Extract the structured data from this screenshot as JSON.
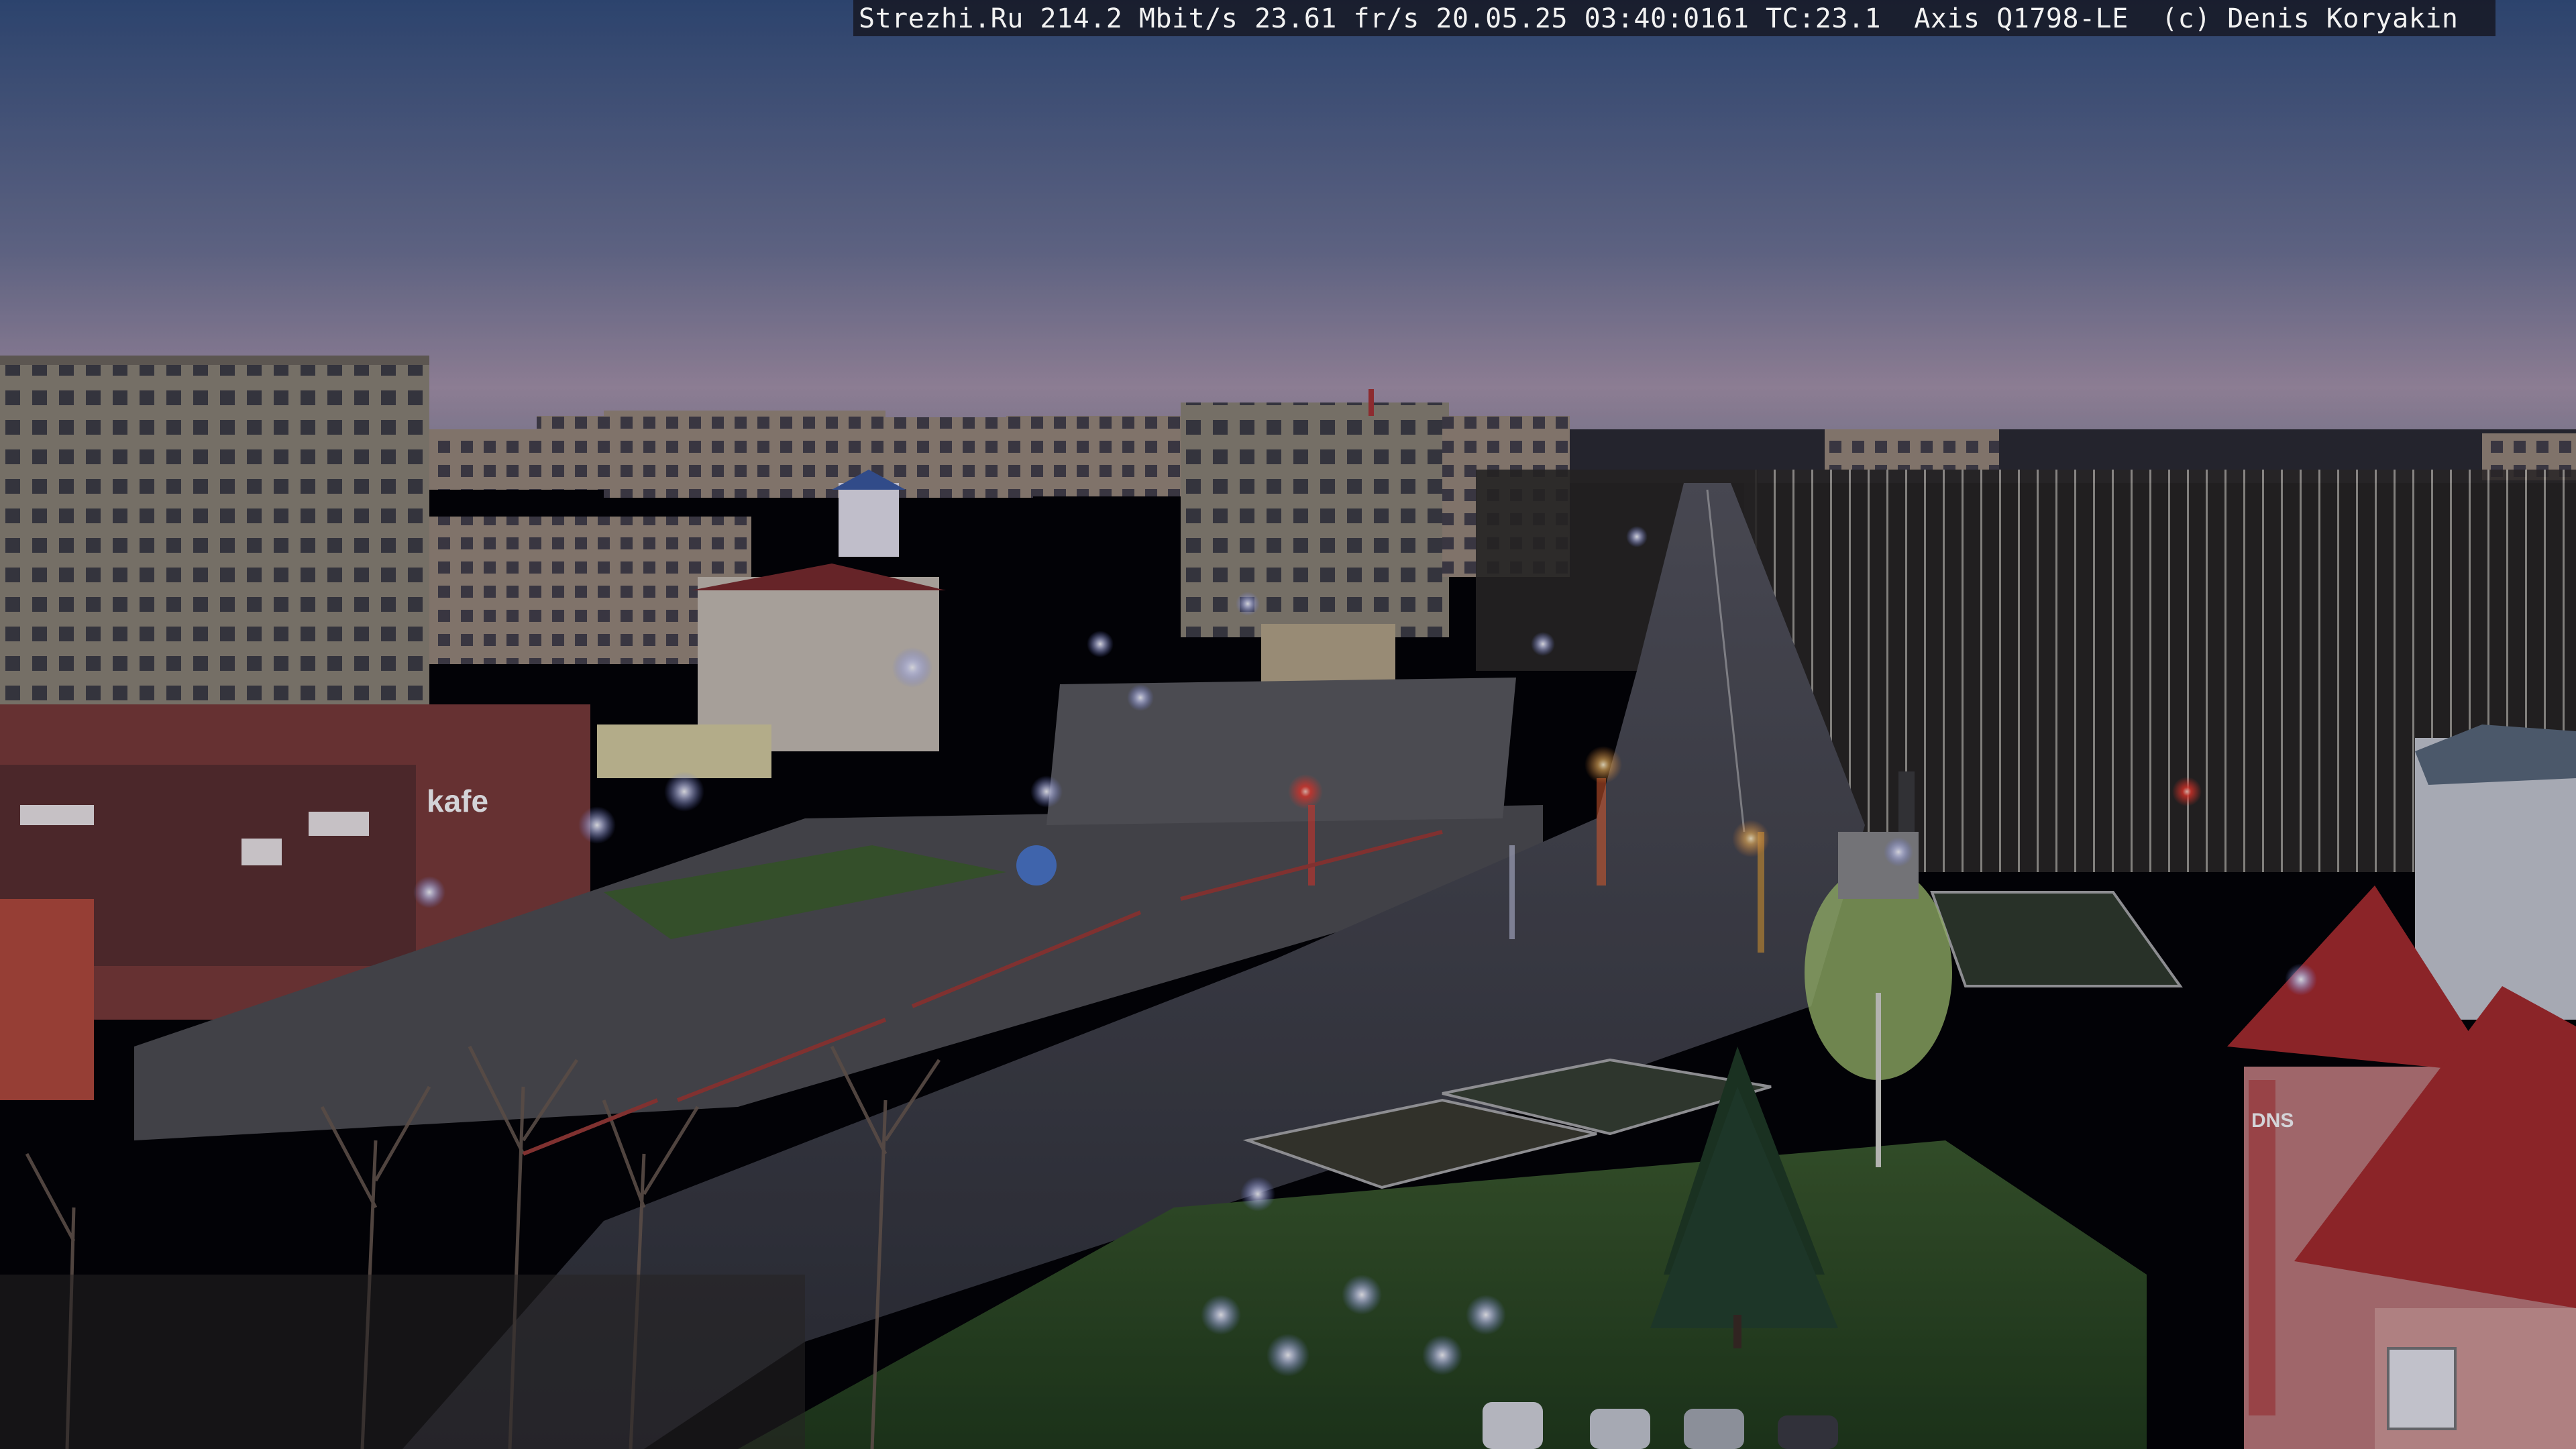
{
  "overlay": {
    "caption": "Strezhi.Ru 214.2 Mbit/s 23.61 fr/s 20.05.25 03:40:0161 TC:23.1  Axis Q1798-LE  (c) Denis Koryakin"
  },
  "signs": {
    "kafe": "kafe",
    "dns": "DNS"
  },
  "colors": {
    "sky_top": "#3c5884",
    "sky_horizon": "#b09aae",
    "asphalt": "#3a3d44",
    "grass": "#2c4a22",
    "street_light": "#eef0ff",
    "traffic_red": "#ff3a2a",
    "traffic_amber": "#ffb030"
  }
}
